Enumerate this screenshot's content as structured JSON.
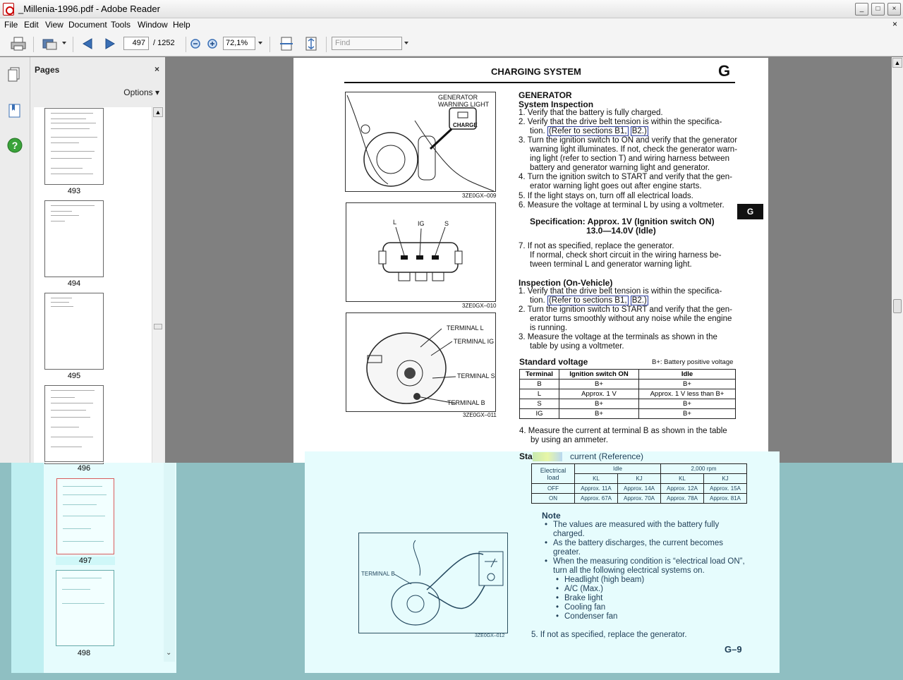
{
  "window": {
    "title": "_Millenia-1996.pdf - Adobe Reader",
    "min_label": "_",
    "max_label": "□",
    "close_label": "×"
  },
  "menu": {
    "file": "File",
    "edit": "Edit",
    "view": "View",
    "document": "Document",
    "tools": "Tools",
    "window": "Window",
    "help": "Help",
    "close": "×"
  },
  "toolbar": {
    "page_current": "497",
    "page_total": "/  1252",
    "zoom": "72,1%",
    "find_placeholder": "Find"
  },
  "pages_panel": {
    "title": "Pages",
    "close": "×",
    "options": "Options",
    "thumbnails": [
      {
        "label": "493"
      },
      {
        "label": "494"
      },
      {
        "label": "495"
      },
      {
        "label": "496"
      },
      {
        "label": "497"
      },
      {
        "label": "498"
      }
    ]
  },
  "document": {
    "header_title": "CHARGING SYSTEM",
    "header_letter": "G",
    "side_tab": "G",
    "fig1_label_generator": "GENERATOR",
    "fig1_label_warning": "WARNING LIGHT",
    "fig1_charge": "CHARGE",
    "fig1_code": "3ZE0GX–009",
    "fig2_L": "L",
    "fig2_IG": "IG",
    "fig2_S": "S",
    "fig2_code": "3ZE0GX–010",
    "fig3_terminal_L": "TERMINAL L",
    "fig3_terminal_IG": "TERMINAL IG",
    "fig3_terminal_S": "TERMINAL S",
    "fig3_terminal_B": "TERMINAL B",
    "fig3_code": "3ZE0GX–011",
    "generator": "GENERATOR",
    "system_inspection": "System Inspection",
    "si_1": "1.  Verify that the battery is fully charged.",
    "si_2a": "2.  Verify that the drive belt tension is within the specifica-",
    "si_2b": "tion.",
    "si_2link1": "(Refer to sections B1,",
    "si_2link2": "B2.)",
    "si_3a": "3.  Turn the ignition switch to ON and verify that the generator",
    "si_3b": "warning light illuminates. If not, check the generator warn-",
    "si_3c": "ing light (refer to section T) and wiring harness between",
    "si_3d": "battery and generator warning light and generator.",
    "si_4a": "4.  Turn the ignition switch to START and verify that the gen-",
    "si_4b": "erator warning light goes out after engine starts.",
    "si_5": "5.  If the light stays on, turn off all electrical loads.",
    "si_6": "6.  Measure the voltage at terminal L by using a voltmeter.",
    "spec_a": "Specification: Approx. 1V (Ignition switch ON)",
    "spec_b": "13.0—14.0V (Idle)",
    "si_7a": "7.  If not as specified, replace the generator.",
    "si_7b": "If normal, check short circuit in the wiring harness be-",
    "si_7c": "tween terminal L and generator warning light.",
    "inspection_on_vehicle": "Inspection (On-Vehicle)",
    "iv_1a": "1.  Verify that the drive belt tension is within the specifica-",
    "iv_1b": "tion.",
    "iv_1link1": "(Refer to sections B1,",
    "iv_1link2": "B2.)",
    "iv_2a": "2.  Turn the ignition switch to START and verify that the gen-",
    "iv_2b": "erator turns smoothly without any noise while the engine",
    "iv_2c": "is running.",
    "iv_3a": "3.  Measure the voltage at the terminals as shown in the",
    "iv_3b": "table by using a voltmeter.",
    "standard_voltage": "Standard voltage",
    "battery_note": "B+: Battery positive voltage",
    "voltage_table": {
      "headers": [
        "Terminal",
        "Ignition switch ON",
        "Idle"
      ],
      "rows": [
        [
          "B",
          "B+",
          "B+"
        ],
        [
          "L",
          "Approx. 1 V",
          "Approx. 1 V less than B+"
        ],
        [
          "S",
          "B+",
          "B+"
        ],
        [
          "IG",
          "B+",
          "B+"
        ]
      ]
    },
    "iv_4a": "4.  Measure the current at terminal B as shown in the table",
    "iv_4b": "by using an ammeter.",
    "std_current_prefix": "Sta",
    "std_current_suffix": "current (Reference)",
    "current_table": {
      "h_load": "Electrical load",
      "h_idle": "Idle",
      "h_2000": "2,000 rpm",
      "sub": [
        "KL",
        "KJ",
        "KL",
        "KJ"
      ],
      "rows": [
        [
          "OFF",
          "Approx. 11A",
          "Approx. 14A",
          "Approx. 12A",
          "Approx. 15A"
        ],
        [
          "ON",
          "Approx. 67A",
          "Approx. 70A",
          "Approx. 78A",
          "Approx. 81A"
        ]
      ]
    },
    "note_title": "Note",
    "note_1a": "The values are measured with the battery fully",
    "note_1b": "charged.",
    "note_2a": "As the battery discharges, the current becomes",
    "note_2b": "greater.",
    "note_3a": "When the measuring condition is “electrical load ON”,",
    "note_3b": "turn all the following electrical systems on.",
    "sub_items": [
      "Headlight (high beam)",
      "A/C (Max.)",
      "Brake light",
      "Cooling fan",
      "Condenser fan"
    ],
    "iv_5": "5.  If not as specified, replace the generator.",
    "fig4_terminal_B": "TERMINAL B",
    "fig4_code": "3ZE0GX–012",
    "page_number": "G–9"
  }
}
